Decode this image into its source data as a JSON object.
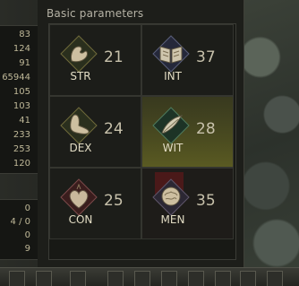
{
  "panel": {
    "title": "Basic parameters"
  },
  "left_stats_top": [
    "83",
    "124",
    "91",
    "65944",
    "105",
    "103",
    "41",
    "233",
    "253",
    "120"
  ],
  "left_stats_bottom": [
    "0",
    "4 / 0",
    "0",
    "9"
  ],
  "stats": [
    {
      "code": "STR",
      "value": "21",
      "icon": "arm-flex-icon"
    },
    {
      "code": "INT",
      "value": "37",
      "icon": "open-book-icon"
    },
    {
      "code": "DEX",
      "value": "24",
      "icon": "foot-icon"
    },
    {
      "code": "WIT",
      "value": "28",
      "icon": "feather-wing-icon"
    },
    {
      "code": "CON",
      "value": "25",
      "icon": "heart-icon"
    },
    {
      "code": "MEN",
      "value": "35",
      "icon": "brain-head-icon"
    }
  ],
  "colors": {
    "panel_bg": "#1d1e1a",
    "highlight": "#4a4b20",
    "text": "#c7c1ab",
    "label": "#e2dcc4"
  }
}
